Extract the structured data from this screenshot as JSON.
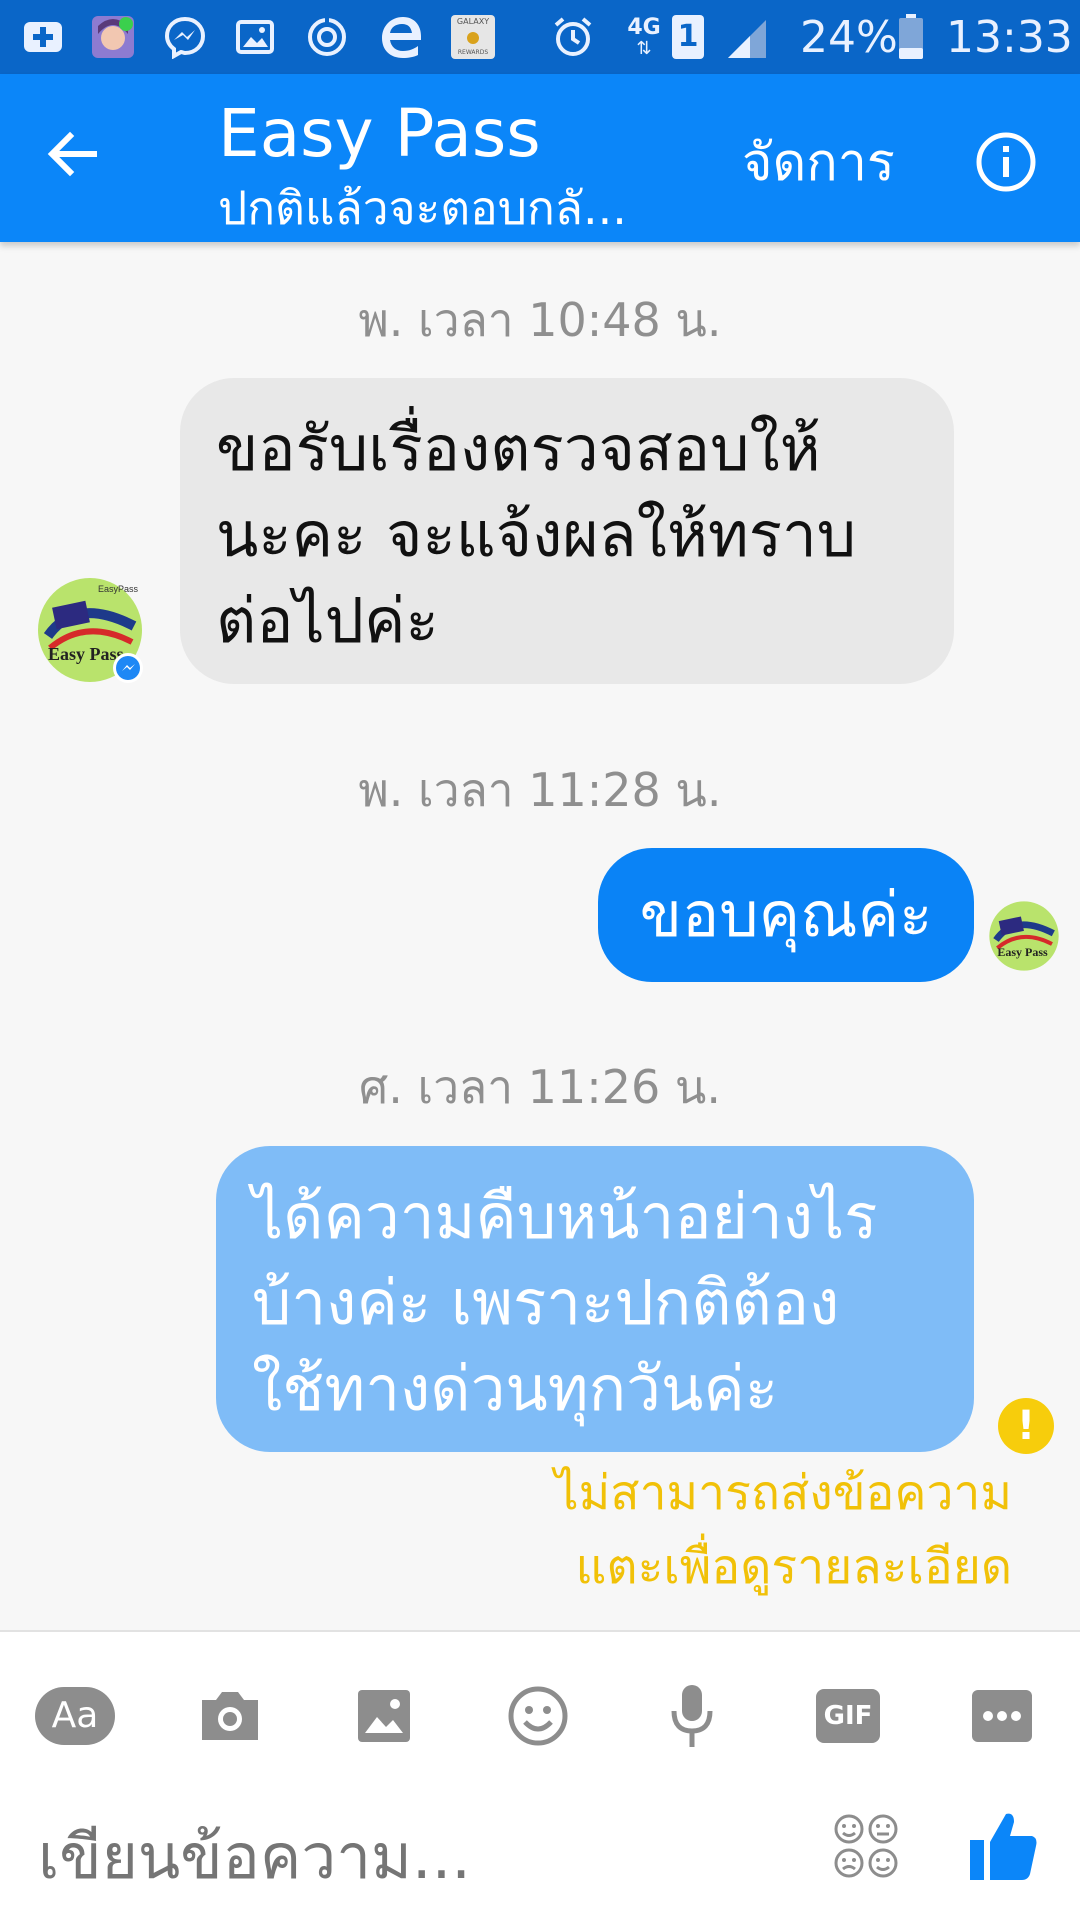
{
  "status_bar": {
    "battery": "24%",
    "time": "13:33",
    "network": "4G",
    "sim": "1",
    "galaxy_line1": "GALAXY",
    "galaxy_line2": "REWARDS",
    "icons": [
      "add-icon",
      "avatar-app-icon",
      "messenger-icon",
      "gallery-icon",
      "sync-icon",
      "edge-icon",
      "galaxy-rewards-icon",
      "alarm-icon",
      "signal-icon",
      "battery-icon"
    ]
  },
  "header": {
    "title": "Easy Pass",
    "subtitle": "ปกติแล้วจะตอบกลั...",
    "manage_label": "จัดการ"
  },
  "conversation": {
    "ts1": "พ. เวลา 10:48 น.",
    "msg1": [
      "ขอรับเรื่องตรวจสอบให้",
      "นะคะ จะแจ้งผลให้ทราบ",
      "ต่อไปค่ะ"
    ],
    "ts2": "พ. เวลา 11:28 น.",
    "msg2": "ขอบคุณค่ะ",
    "ts3": "ศ. เวลา 11:26 น.",
    "msg3": [
      "ได้ความคืบหน้าอย่างไร",
      "บ้างค่ะ เพราะปกติต้อง",
      "ใช้ทางด่วนทุกวันค่ะ"
    ],
    "error_mark": "!",
    "fail_note": [
      "ไม่สามารถส่งข้อความ",
      "แตะเพื่อดูรายละเอียด"
    ]
  },
  "avatar": {
    "logo_text": "Easy Pass",
    "small_text": "EasyPass"
  },
  "composer": {
    "aa_label": "Aa",
    "gif_label": "GIF",
    "placeholder": "เขียนข้อความ..."
  },
  "colors": {
    "header": "#0b86f9",
    "status_bar": "#0a66c8",
    "outgoing": "#0a83f6",
    "failed": "#7fbcf7",
    "incoming": "#e8e8e8",
    "warning": "#f7cd0c"
  }
}
